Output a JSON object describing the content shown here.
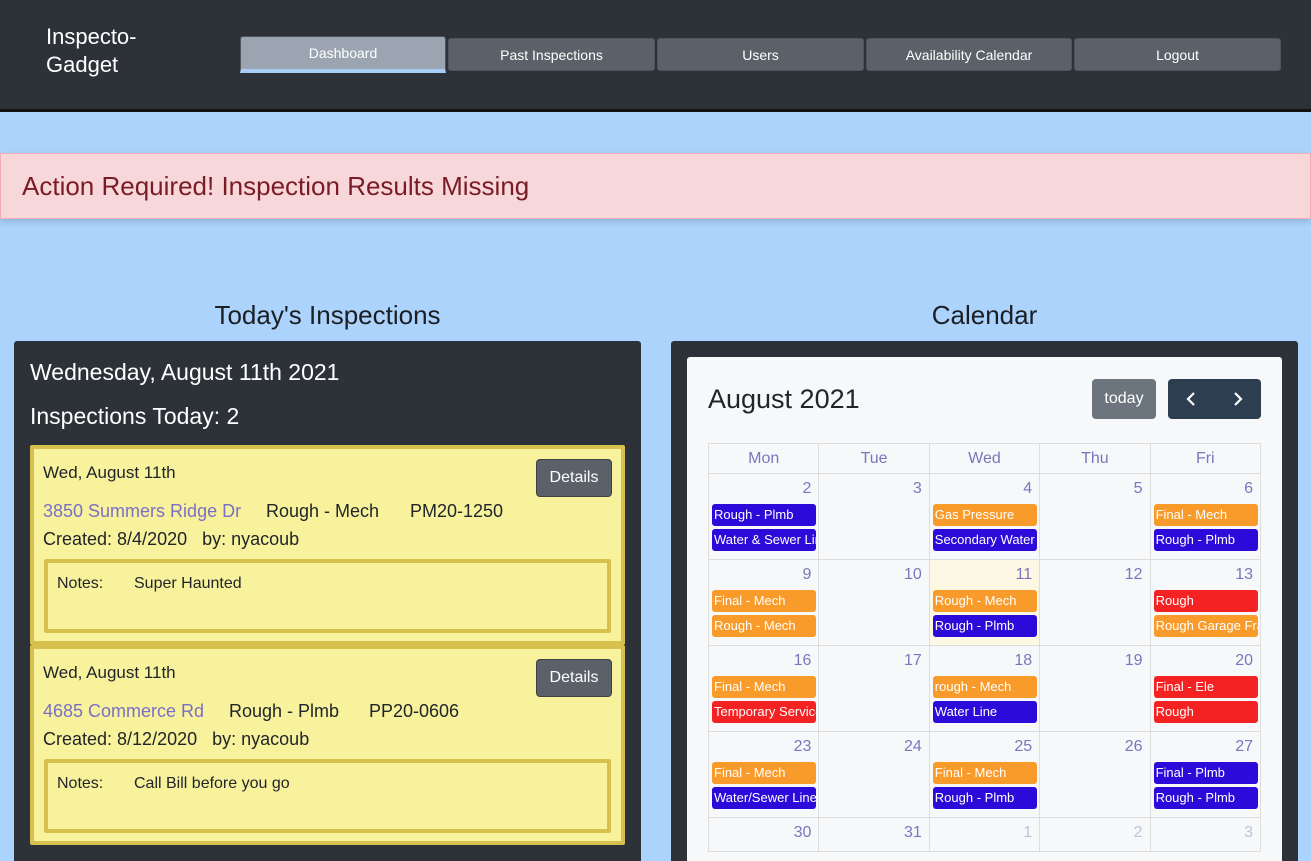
{
  "brand": "Inspecto-Gadget",
  "nav": [
    {
      "label": "Dashboard",
      "active": true
    },
    {
      "label": "Past Inspections",
      "active": false
    },
    {
      "label": "Users",
      "active": false
    },
    {
      "label": "Availability Calendar",
      "active": false
    },
    {
      "label": "Logout",
      "active": false
    }
  ],
  "alert": "Action Required! Inspection Results Missing",
  "left": {
    "title": "Today's Inspections",
    "date": "Wednesday, August 11th 2021",
    "count": "Inspections Today: 2",
    "cards": [
      {
        "date": "Wed, August 11th",
        "details": "Details",
        "address": "3850 Summers Ridge Dr",
        "type": "Rough - Mech",
        "permit": "PM20-1250",
        "created": "Created: 8/4/2020",
        "by": "by: nyacoub",
        "notes_label": "Notes:",
        "notes": "Super Haunted"
      },
      {
        "date": "Wed, August 11th",
        "details": "Details",
        "address": "4685 Commerce Rd",
        "type": "Rough - Plmb",
        "permit": "PP20-0606",
        "created": "Created: 8/12/2020",
        "by": "by: nyacoub",
        "notes_label": "Notes:",
        "notes": "Call Bill before you go"
      }
    ]
  },
  "calendar": {
    "section_title": "Calendar",
    "month": "August 2021",
    "today_label": "today",
    "prev_icon": "‹",
    "next_icon": "›",
    "weekdays": [
      "Mon",
      "Tue",
      "Wed",
      "Thu",
      "Fri"
    ],
    "weeks": [
      [
        {
          "day": "2",
          "events": [
            {
              "t": "Rough - Plmb",
              "c": "blue"
            },
            {
              "t": "Water & Sewer Line",
              "c": "blue"
            }
          ]
        },
        {
          "day": "3",
          "events": []
        },
        {
          "day": "4",
          "events": [
            {
              "t": "Gas Pressure",
              "c": "orange"
            },
            {
              "t": "Secondary Water",
              "c": "blue"
            }
          ]
        },
        {
          "day": "5",
          "events": []
        },
        {
          "day": "6",
          "events": [
            {
              "t": "Final - Mech",
              "c": "orange"
            },
            {
              "t": "Rough - Plmb",
              "c": "blue"
            }
          ]
        }
      ],
      [
        {
          "day": "9",
          "events": [
            {
              "t": "Final - Mech",
              "c": "orange"
            },
            {
              "t": "Rough - Mech",
              "c": "orange"
            }
          ]
        },
        {
          "day": "10",
          "events": []
        },
        {
          "day": "11",
          "today": true,
          "events": [
            {
              "t": "Rough - Mech",
              "c": "orange"
            },
            {
              "t": "Rough - Plmb",
              "c": "blue"
            }
          ]
        },
        {
          "day": "12",
          "events": []
        },
        {
          "day": "13",
          "events": [
            {
              "t": "Rough",
              "c": "red"
            },
            {
              "t": "Rough Garage Framing",
              "c": "orange"
            }
          ]
        }
      ],
      [
        {
          "day": "16",
          "events": [
            {
              "t": "Final - Mech",
              "c": "orange"
            },
            {
              "t": "Temporary Service",
              "c": "red"
            }
          ]
        },
        {
          "day": "17",
          "events": []
        },
        {
          "day": "18",
          "events": [
            {
              "t": "rough - Mech",
              "c": "orange"
            },
            {
              "t": "Water Line",
              "c": "blue"
            }
          ]
        },
        {
          "day": "19",
          "events": []
        },
        {
          "day": "20",
          "events": [
            {
              "t": "Final - Ele",
              "c": "red"
            },
            {
              "t": "Rough",
              "c": "red"
            }
          ]
        }
      ],
      [
        {
          "day": "23",
          "events": [
            {
              "t": "Final - Mech",
              "c": "orange"
            },
            {
              "t": "Water/Sewer Line",
              "c": "blue"
            }
          ]
        },
        {
          "day": "24",
          "events": []
        },
        {
          "day": "25",
          "events": [
            {
              "t": "Final - Mech",
              "c": "orange"
            },
            {
              "t": "Rough - Plmb",
              "c": "blue"
            }
          ]
        },
        {
          "day": "26",
          "events": []
        },
        {
          "day": "27",
          "events": [
            {
              "t": "Final - Plmb",
              "c": "blue"
            },
            {
              "t": "Rough - Plmb",
              "c": "blue"
            }
          ]
        }
      ],
      [
        {
          "day": "30",
          "events": []
        },
        {
          "day": "31",
          "events": []
        },
        {
          "day": "1",
          "other": true,
          "events": []
        },
        {
          "day": "2",
          "other": true,
          "events": []
        },
        {
          "day": "3",
          "other": true,
          "events": []
        }
      ]
    ]
  }
}
